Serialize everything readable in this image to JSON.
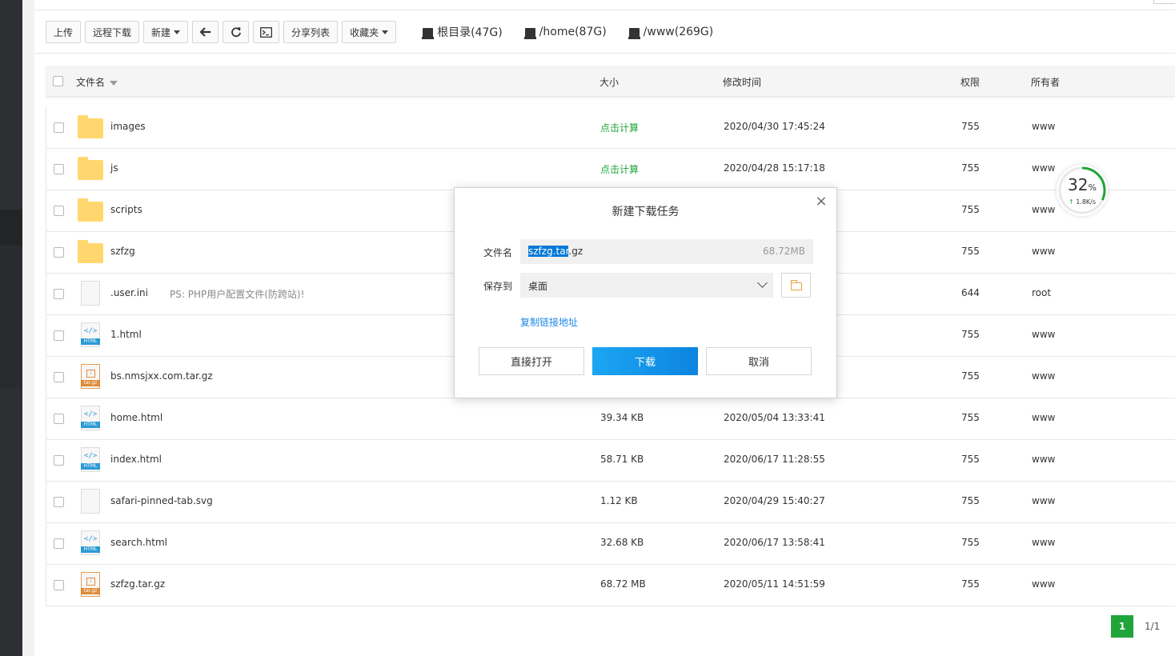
{
  "toolbar": {
    "upload": "上传",
    "remote_download": "远程下载",
    "new": "新建",
    "share_list": "分享列表",
    "favorites": "收藏夹"
  },
  "disks": [
    {
      "label": "根目录(47G)"
    },
    {
      "label": "/home(87G)"
    },
    {
      "label": "/www(269G)"
    }
  ],
  "table": {
    "headers": {
      "name": "文件名",
      "size": "大小",
      "mtime": "修改时间",
      "perm": "权限",
      "owner": "所有者"
    },
    "rows": [
      {
        "name": "images",
        "type": "folder",
        "size": "点击计算",
        "mtime": "2020/04/30 17:45:24",
        "perm": "755",
        "owner": "www"
      },
      {
        "name": "js",
        "type": "folder",
        "size": "点击计算",
        "mtime": "2020/04/28 15:17:18",
        "perm": "755",
        "owner": "www"
      },
      {
        "name": "scripts",
        "type": "folder",
        "size": "",
        "mtime": "",
        "perm": "755",
        "owner": "www"
      },
      {
        "name": "szfzg",
        "type": "folder",
        "size": "",
        "mtime": "",
        "perm": "755",
        "owner": "www"
      },
      {
        "name": ".user.ini",
        "type": "file",
        "note": "PS: PHP用户配置文件(防跨站)!",
        "size": "",
        "mtime": "",
        "perm": "644",
        "owner": "root"
      },
      {
        "name": "1.html",
        "type": "html",
        "size": "",
        "mtime": "",
        "perm": "755",
        "owner": "www"
      },
      {
        "name": "bs.nmsjxx.com.tar.gz",
        "type": "gz",
        "size": "",
        "mtime": "",
        "perm": "755",
        "owner": "www"
      },
      {
        "name": "home.html",
        "type": "html",
        "size": "39.34 KB",
        "mtime": "2020/05/04 13:33:41",
        "perm": "755",
        "owner": "www"
      },
      {
        "name": "index.html",
        "type": "html",
        "size": "58.71 KB",
        "mtime": "2020/06/17 11:28:55",
        "perm": "755",
        "owner": "www"
      },
      {
        "name": "safari-pinned-tab.svg",
        "type": "file",
        "size": "1.12 KB",
        "mtime": "2020/04/29 15:40:27",
        "perm": "755",
        "owner": "www"
      },
      {
        "name": "search.html",
        "type": "html",
        "size": "32.68 KB",
        "mtime": "2020/06/17 13:58:41",
        "perm": "755",
        "owner": "www"
      },
      {
        "name": "szfzg.tar.gz",
        "type": "gz",
        "size": "68.72 MB",
        "mtime": "2020/05/11 14:51:59",
        "perm": "755",
        "owner": "www"
      }
    ]
  },
  "pager": {
    "current": "1",
    "total": "1/1"
  },
  "net_monitor": {
    "percent": "32",
    "percent_unit": "%",
    "speed": "1.8K/s",
    "speed_arrow": "↑",
    "level": 0.32
  },
  "dialog": {
    "title": "新建下载任务",
    "close": "×",
    "filename_label": "文件名",
    "filename_selected": "szfzg.tar",
    "filename_rest": ".gz",
    "file_size": "68.72MB",
    "save_to_label": "保存到",
    "save_to_value": "桌面",
    "copy_link": "复制链接地址",
    "btn_open": "直接打开",
    "btn_download": "下载",
    "btn_cancel": "取消"
  },
  "colors": {
    "accent_green": "#20a53a",
    "primary_blue": "#0d84e0",
    "link_blue": "#1e88e5"
  }
}
